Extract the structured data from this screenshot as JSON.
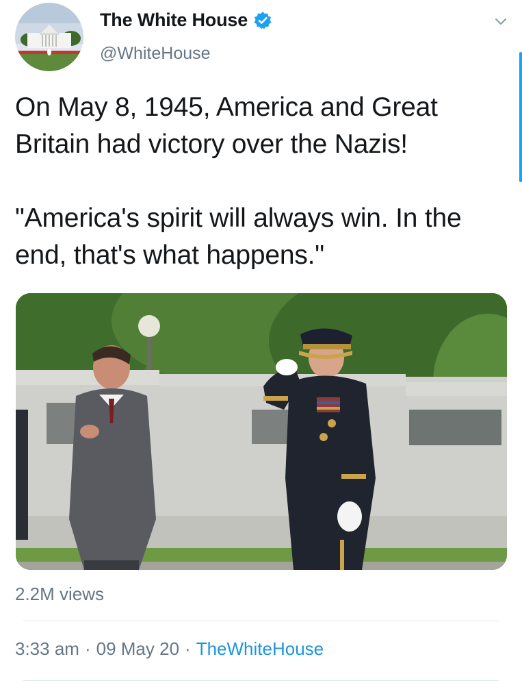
{
  "account": {
    "display_name": "The White House",
    "handle": "@WhiteHouse",
    "verified": true
  },
  "tweet": {
    "paragraphs": [
      "On May 8, 1945, America and Great Britain had victory over the Nazis!",
      "\"America's spirit will always win. In the end, that's what happens.\""
    ],
    "media_description": "video",
    "views": "2.2M views",
    "time": "3:33 am",
    "separator": "·",
    "date": "09 May 20",
    "source": "TheWhiteHouse"
  },
  "icons": {
    "verified": "verified-badge-icon",
    "caret": "chevron-down-icon"
  },
  "colors": {
    "accent": "#1da1f2",
    "link": "#1b95e0",
    "secondary_text": "#657786",
    "text": "#14171a"
  }
}
